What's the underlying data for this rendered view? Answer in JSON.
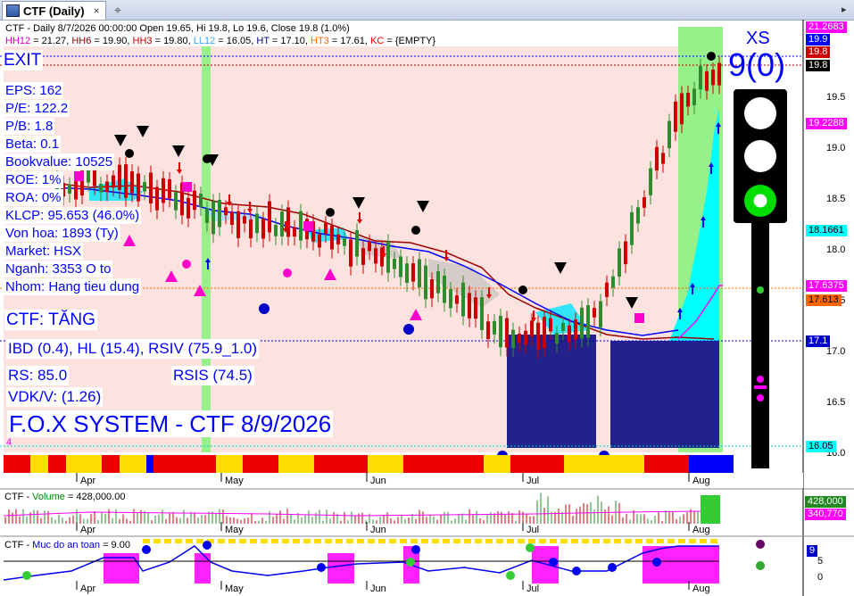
{
  "window": {
    "tab_title": "CTF (Daily)",
    "close_symbol": "×",
    "add_tab_symbol": "⌖"
  },
  "header": {
    "line1": "CTF - Daily 8/7/2026 00:00:00 Open 19.65, Hi 19.8, Lo 19.6, Close 19.8 (1.0%)",
    "line2_parts": [
      {
        "text": "HH12",
        "color": "#cc00cc"
      },
      {
        "text": " = 21.27, ",
        "color": "#000000"
      },
      {
        "text": "HH6",
        "color": "#800000"
      },
      {
        "text": " = 19.90, ",
        "color": "#000000"
      },
      {
        "text": "HH3",
        "color": "#c00000"
      },
      {
        "text": " = 19.80, ",
        "color": "#000000"
      },
      {
        "text": "LL12",
        "color": "#33aaff"
      },
      {
        "text": " = 16.05, ",
        "color": "#000000"
      },
      {
        "text": "HT",
        "color": "#000080"
      },
      {
        "text": "  = 17.10, ",
        "color": "#000000"
      },
      {
        "text": "HT3",
        "color": "#ff6600"
      },
      {
        "text": "  = 17.61, ",
        "color": "#000000"
      },
      {
        "text": "KC",
        "color": "#ff0000"
      },
      {
        "text": " = {EMPTY}",
        "color": "#000000"
      }
    ]
  },
  "overlay": {
    "exit": "EXIT",
    "fundamentals": [
      "EPS: 162",
      "P/E: 122.2",
      "P/B: 1.8",
      "Beta: 0.1",
      "Bookvalue: 10525",
      "ROE: 1%",
      "ROA: 0%",
      "KLCP: 95.653 (46.0%)",
      "Von hoa: 1893 (Ty)",
      "Market: HSX",
      "Nganh: 3353 O to",
      "Nhom: Hang tieu dung"
    ],
    "trend": "CTF: TĂNG",
    "ibd_line": "IBD (0.4), HL (15.4), RSIV (75.9_1.0)",
    "rs": "RS: 85.0",
    "rsis": "RSIS (74.5)",
    "vdk": "VDK/V:  (1.26)",
    "system": "F.O.X SYSTEM - CTF 8/9/2026",
    "counter": "4"
  },
  "signal": {
    "label": "XS",
    "value": "9(0)"
  },
  "price_axis": {
    "ticks": [
      "19.5",
      "19.0",
      "18.5",
      "18.0",
      "17.5",
      "17.0",
      "16.5",
      "16.0"
    ],
    "boxes": [
      {
        "text": "21.2683",
        "bg": "#ff00ff",
        "fg": "#ffffff"
      },
      {
        "text": "19.9",
        "bg": "#0000ff",
        "fg": "#ffffff"
      },
      {
        "text": "19.8",
        "bg": "#cc0000",
        "fg": "#ffffff"
      },
      {
        "text": "19.8",
        "bg": "#000000",
        "fg": "#ffffff"
      },
      {
        "text": "19.2288",
        "bg": "#ff00ff",
        "fg": "#ffffff"
      },
      {
        "text": "18.1661",
        "bg": "#00ffff",
        "fg": "#000000"
      },
      {
        "text": "17.6375",
        "bg": "#ff00ff",
        "fg": "#ffffff"
      },
      {
        "text": "17.613",
        "bg": "#ff6600",
        "fg": "#000000"
      },
      {
        "text": "17.1",
        "bg": "#0000cc",
        "fg": "#ffffff"
      },
      {
        "text": "16.05",
        "bg": "#00ffff",
        "fg": "#000000"
      }
    ]
  },
  "months": [
    "Apr",
    "May",
    "Jun",
    "Jul",
    "Aug"
  ],
  "volume_panel": {
    "title_prefix": "CTF - ",
    "title_name": "Volume",
    "title_value": " = 428,000.00",
    "box_volume": "428,000",
    "box_ma": "340,770"
  },
  "safety_panel": {
    "title_prefix": "CTF - ",
    "title_name": "Muc do an toan",
    "title_value": " = 9.00",
    "box_value": "9",
    "ticks": [
      "5",
      "0"
    ]
  },
  "colors": {
    "background_zone": "#fde3df",
    "green_zone": "#98f08a",
    "band_cyan": "#00ffff",
    "navy_block": "#22228a",
    "up_candle": "#2e8b2e",
    "down_candle": "#cc0000",
    "ma_line": "#a00000",
    "blue_line": "#0000ff"
  }
}
